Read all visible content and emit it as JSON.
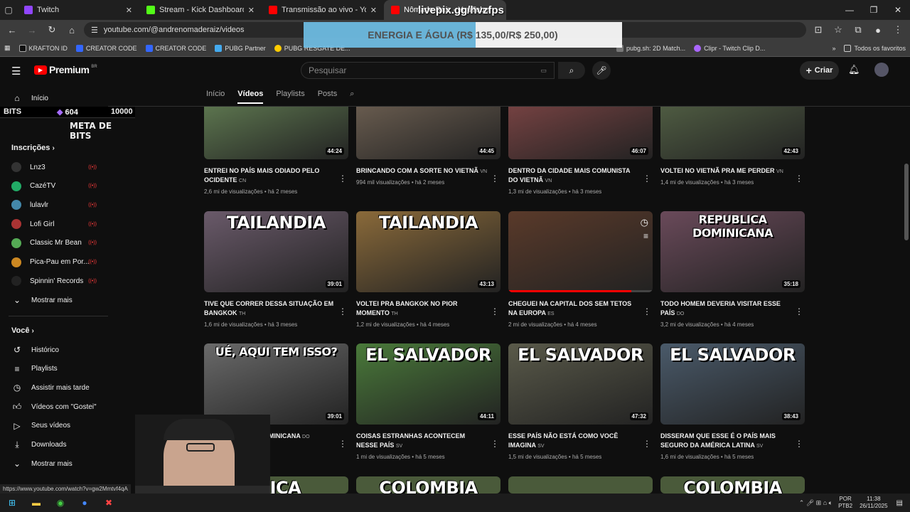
{
  "tabs": [
    {
      "title": "Twitch",
      "color": "#9146ff"
    },
    {
      "title": "Stream - Kick Dashboard",
      "color": "#53fc18"
    },
    {
      "title": "Transmissão ao vivo - YouTube",
      "color": "#ff0000"
    },
    {
      "title": "Nômade Raiz - YouTube",
      "color": "#ff0000"
    }
  ],
  "url": "youtube.com/@andrenomaderaiz/videos",
  "bookmarks": [
    "KRAFTON ID",
    "CREATOR CODE",
    "CREATOR CODE",
    "PUBG Partner",
    "PUBG RESGATE DE...",
    "pubg.sh: 2D Match...",
    "Clipr - Twitch Clip D..."
  ],
  "bookmarks_all": "Todos os favoritos",
  "overlay": {
    "livepix": "livepix.gg/hvzfps",
    "goal": "ENERGIA E ÁGUA (R$ 135,00/R$ 250,00)",
    "progress": 0.54
  },
  "logo": {
    "text": "Premium",
    "badge": "BR"
  },
  "search": {
    "placeholder": "Pesquisar"
  },
  "create": "Criar",
  "channel_tabs": [
    "Início",
    "Vídeos",
    "Playlists",
    "Posts"
  ],
  "bits": {
    "label": "BITS",
    "count": "604",
    "goal": "10000",
    "caption": "META DE BITS"
  },
  "sidebar": {
    "home": "Início",
    "subs_title": "Inscrições",
    "subs": [
      {
        "name": "Lnz3",
        "color": "#333"
      },
      {
        "name": "CazéTV",
        "color": "#2a6"
      },
      {
        "name": "lulavlr",
        "color": "#48a"
      },
      {
        "name": "Lofi Girl",
        "color": "#a33"
      },
      {
        "name": "Classic Mr Bean",
        "color": "#5a5"
      },
      {
        "name": "Pica-Pau em Por...",
        "color": "#c82"
      },
      {
        "name": "Spinnin' Records",
        "color": "#222"
      }
    ],
    "more": "Mostrar mais",
    "you_title": "Você",
    "you": [
      "Histórico",
      "Playlists",
      "Assistir mais tarde",
      "Vídeos com \"Gostei\"",
      "Seus vídeos",
      "Downloads",
      "Mostrar mais"
    ]
  },
  "videos": [
    {
      "title": "ENTREI NO PAÍS MAIS ODIADO PELO OCIDENTE",
      "cc": "CN",
      "meta": "2,6 mi de visualizações • há 2 meses",
      "dur": "44:24",
      "bg": "#6b8a5a",
      "label": ""
    },
    {
      "title": "BRINCANDO COM A SORTE NO VIETNÃ",
      "cc": "VN",
      "meta": "994 mil visualizações • há 2 meses",
      "dur": "44:45",
      "bg": "#7a6a5a",
      "label": ""
    },
    {
      "title": "DENTRO DA CIDADE MAIS COMUNISTA DO VIETNÃ",
      "cc": "VN",
      "meta": "1,3 mi de visualizações • há 3 meses",
      "dur": "46:07",
      "bg": "#8a4a4a",
      "label": ""
    },
    {
      "title": "VOLTEI NO VIETNÃ PRA ME PERDER",
      "cc": "VN",
      "meta": "1,4 mi de visualizações • há 3 meses",
      "dur": "42:43",
      "bg": "#5a6a4a",
      "label": ""
    },
    {
      "title": "TIVE QUE CORRER DESSA SITUAÇÃO EM BANGKOK",
      "cc": "TH",
      "meta": "1,6 mi de visualizações • há 3 meses",
      "dur": "39:01",
      "bg": "#6a5a6a",
      "label": "TAILANDIA"
    },
    {
      "title": "VOLTEI PRA BANGKOK NO PIOR MOMENTO",
      "cc": "TH",
      "meta": "1,2 mi de visualizações • há 4 meses",
      "dur": "43:13",
      "bg": "#8a6a3a",
      "label": "TAILANDIA"
    },
    {
      "title": "CHEGUEI NA CAPITAL DOS SEM TETOS NA EUROPA",
      "cc": "ES",
      "meta": "2 mi de visualizações • há 4 meses",
      "dur": "",
      "bg": "#5a3a2a",
      "label": ""
    },
    {
      "title": "TODO HOMEM DEVERIA VISITAR ESSE PAÍS",
      "cc": "DO",
      "meta": "3,2 mi de visualizações • há 4 meses",
      "dur": "35:18",
      "bg": "#6a4a5a",
      "label": "REPUBLICA DOMINICANA"
    },
    {
      "title": "...NA REPÚBLICA DOMINICANA",
      "cc": "DO",
      "meta": "há 4 meses",
      "dur": "39:01",
      "bg": "#6a6a6a",
      "label": "UÉ, AQUI TEM ISSO?"
    },
    {
      "title": "COISAS ESTRANHAS ACONTECEM NESSE PAÍS",
      "cc": "SV",
      "meta": "1 mi de visualizações • há 5 meses",
      "dur": "44:11",
      "bg": "#4a7a3a",
      "label": "EL SALVADOR"
    },
    {
      "title": "ESSE PAÍS NÃO ESTÁ COMO VOCÊ IMAGINA",
      "cc": "SV",
      "meta": "1,5 mi de visualizações • há 5 meses",
      "dur": "47:32",
      "bg": "#5a5a4a",
      "label": "EL SALVADOR"
    },
    {
      "title": "DISSERAM QUE ESSE É O PAÍS MAIS SEGURO DA AMÉRICA LATINA",
      "cc": "SV",
      "meta": "1,6 mi de visualizações • há 5 meses",
      "dur": "38:43",
      "bg": "#4a5a6a",
      "label": "EL SALVADOR"
    }
  ],
  "next_row": [
    "...ICA",
    "COLOMBIA",
    "",
    "COLOMBIA"
  ],
  "status_url": "https://www.youtube.com/watch?v=gw2Mmtvf4qA",
  "tray": {
    "lang": "POR",
    "kbd": "PTB2",
    "time": "11:38",
    "date": "26/11/2025"
  }
}
